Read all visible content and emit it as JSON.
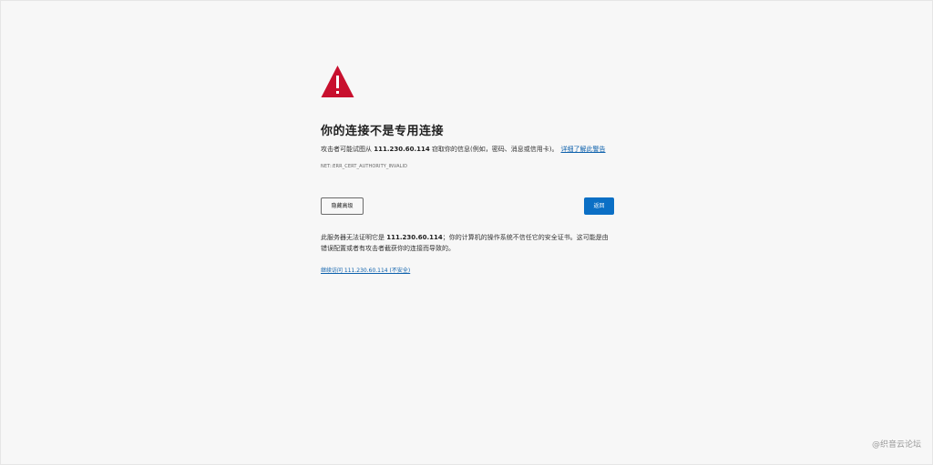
{
  "page": {
    "title": "你的连接不是专用连接",
    "description_prefix": "攻击者可能试图从",
    "host": "111.230.60.114",
    "description_suffix": "窃取你的信息(例如，密码、消息或信用卡)。",
    "learn_more_link": "详细了解此警告",
    "error_code": "NET::ERR_CERT_AUTHORITY_INVALID"
  },
  "buttons": {
    "advanced_label": "隐藏高级",
    "back_label": "返回"
  },
  "advanced": {
    "detail_prefix": "此服务器无法证明它是",
    "host": "111.230.60.114",
    "detail_suffix": "；你的计算机的操作系统不信任它的安全证书。这可能是由错误配置或者有攻击者截获你的连接而导致的。",
    "proceed_link": "继续访问 111.230.60.114 (不安全)"
  },
  "watermark": {
    "text": "@织音云论坛"
  },
  "icons": {
    "warning": "warning-triangle-icon"
  },
  "colors": {
    "warning_red": "#c8102e",
    "link_blue": "#0f62ad",
    "primary_button": "#0b6fc5",
    "background": "#f7f7f7"
  }
}
